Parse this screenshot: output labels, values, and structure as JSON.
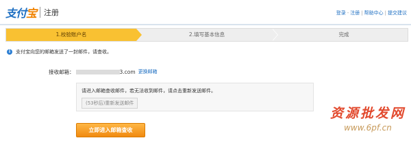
{
  "header": {
    "logo_main": "支付",
    "logo_accent": "宝",
    "section_title": "注册",
    "links": [
      "登录",
      "注册",
      "帮助中心",
      "提交建议"
    ]
  },
  "steps": [
    {
      "label": "1.校验账户名",
      "active": true
    },
    {
      "label": "2.填写基本信息",
      "active": false
    },
    {
      "label": "完成",
      "active": false
    }
  ],
  "notice": {
    "icon": "info-icon",
    "text": "支付宝向您的邮箱发送了一封邮件，请查收。"
  },
  "email": {
    "label": "接收邮箱：",
    "domain_suffix": "3.com",
    "change_link": "更换邮箱"
  },
  "resend_box": {
    "hint": "请进入邮箱查收邮件，若无法收到邮件，请点击重新发送邮件。",
    "resend_label": "(53秒后)重新发送邮件"
  },
  "primary_button": "立即进入邮箱查收",
  "watermark": {
    "cn": "资源批发网",
    "url": "www.6pf.cn"
  },
  "colors": {
    "brand_blue": "#1e6fc2",
    "active_step": "#f9c132",
    "button_orange": "#f08a10",
    "watermark_red": "#e24a2e"
  }
}
